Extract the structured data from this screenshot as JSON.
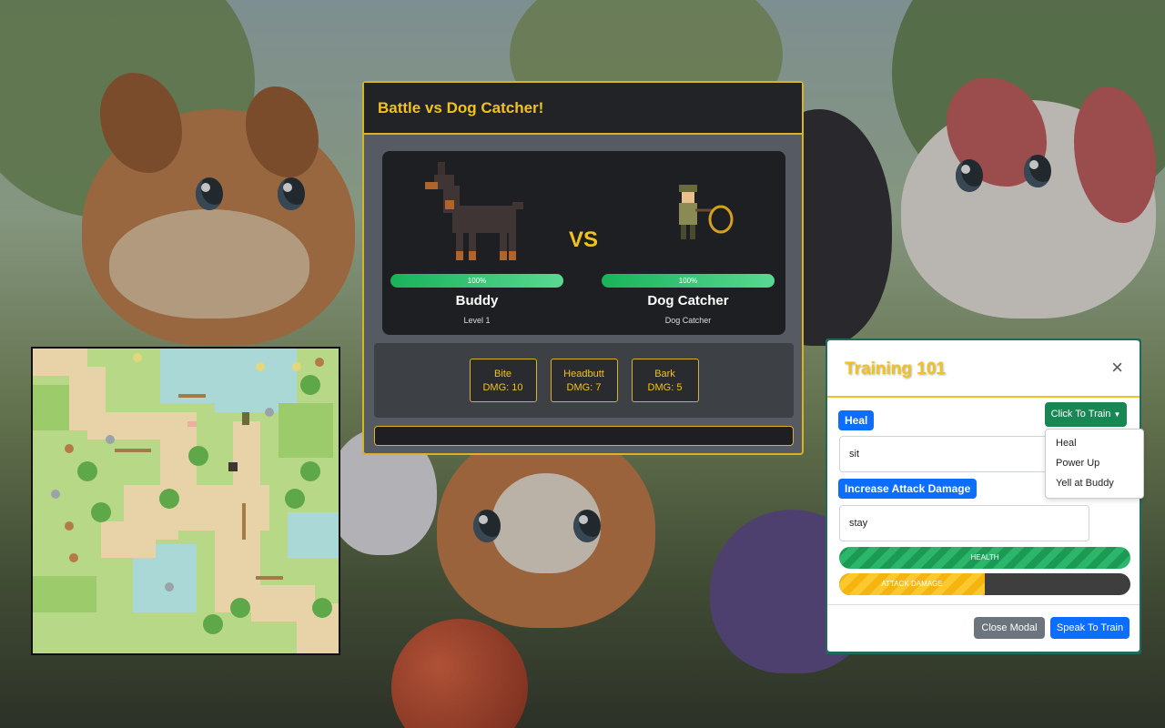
{
  "battle": {
    "title": "Battle vs Dog Catcher!",
    "vs_label": "VS",
    "player": {
      "name": "Buddy",
      "subtitle": "Level 1",
      "hp_percent": 100,
      "hp_label": "100%"
    },
    "enemy": {
      "name": "Dog Catcher",
      "subtitle": "Dog Catcher",
      "hp_percent": 100,
      "hp_label": "100%"
    },
    "moves": [
      {
        "name": "Bite",
        "damage": "DMG: 10"
      },
      {
        "name": "Headbutt",
        "damage": "DMG: 7"
      },
      {
        "name": "Bark",
        "damage": "DMG: 5"
      }
    ],
    "log": ""
  },
  "training": {
    "title": "Training 101",
    "close_icon": "close-icon",
    "badge_heal": "Heal",
    "input_heal": "sit",
    "badge_attack": "Increase Attack Damage",
    "input_attack": "stay",
    "dropdown": {
      "label": "Click To Train",
      "items": [
        "Heal",
        "Power Up",
        "Yell at Buddy"
      ]
    },
    "health_bar": {
      "label": "HEALTH",
      "percent": 100
    },
    "attack_bar": {
      "label": "ATTACK DAMAGE",
      "percent": 50
    },
    "close_modal_label": "Close Modal",
    "speak_label": "Speak To Train"
  },
  "colors": {
    "accent_gold": "#f2c21c",
    "hp_green": "#2ecc71",
    "primary_blue": "#0d6efd",
    "success_green": "#198754",
    "secondary_gray": "#6c757d"
  }
}
